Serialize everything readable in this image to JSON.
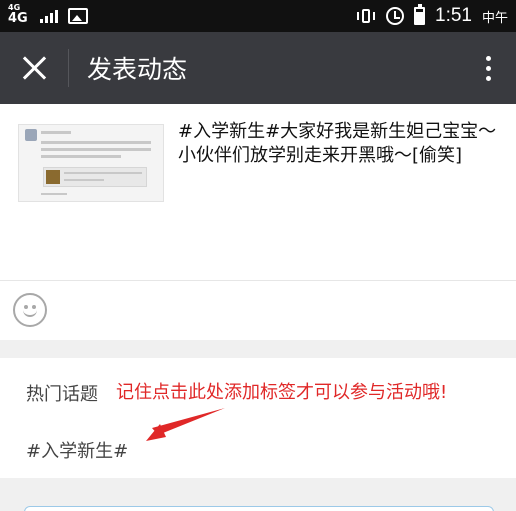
{
  "status_bar": {
    "network_sup": "4G",
    "network": "4G",
    "time": "1:51",
    "ampm": "中午"
  },
  "app_bar": {
    "title": "发表动态"
  },
  "compose": {
    "text": "#入学新生#大家好我是新生妲己宝宝～小伙伴们放学别走来开黑哦～[偷笑]"
  },
  "topics": {
    "label": "热门话题",
    "annotation": "记住点击此处添加标签才可以参与活动哦!",
    "tag": "#入学新生#"
  },
  "colors": {
    "app_bar": "#393a3f",
    "annotation": "#e02828",
    "arrow": "#e02828"
  },
  "icons": [
    "close-icon",
    "more-vert-icon",
    "emoji-icon",
    "photo-icon",
    "vibrate-icon",
    "alarm-icon",
    "battery-icon"
  ]
}
